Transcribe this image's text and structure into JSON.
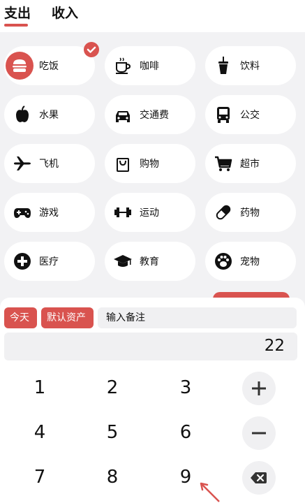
{
  "tabs": {
    "expense": "支出",
    "income": "收入",
    "active": "expense"
  },
  "accent_color": "#d9534f",
  "categories": [
    {
      "label": "吃饭",
      "icon": "hamburger-icon",
      "selected": true
    },
    {
      "label": "咖啡",
      "icon": "coffee-cup-icon"
    },
    {
      "label": "饮料",
      "icon": "drink-cup-icon"
    },
    {
      "label": "水果",
      "icon": "apple-icon"
    },
    {
      "label": "交通费",
      "icon": "car-icon"
    },
    {
      "label": "公交",
      "icon": "bus-icon"
    },
    {
      "label": "飞机",
      "icon": "airplane-icon"
    },
    {
      "label": "购物",
      "icon": "shopping-bag-icon"
    },
    {
      "label": "超市",
      "icon": "shopping-cart-icon"
    },
    {
      "label": "游戏",
      "icon": "gamepad-icon"
    },
    {
      "label": "运动",
      "icon": "dumbbell-icon"
    },
    {
      "label": "药物",
      "icon": "pill-icon"
    },
    {
      "label": "医疗",
      "icon": "medical-cross-icon"
    },
    {
      "label": "教育",
      "icon": "graduation-cap-icon"
    },
    {
      "label": "宠物",
      "icon": "paw-icon"
    }
  ],
  "entry": {
    "date_chip": "今天",
    "asset_chip": "默认资产",
    "note_placeholder": "输入备注",
    "amount": "22"
  },
  "keypad": {
    "digits": [
      "1",
      "2",
      "3",
      "4",
      "5",
      "6",
      "7",
      "8",
      "9"
    ],
    "ops": [
      "plus-icon",
      "minus-icon",
      "backspace-icon"
    ]
  }
}
